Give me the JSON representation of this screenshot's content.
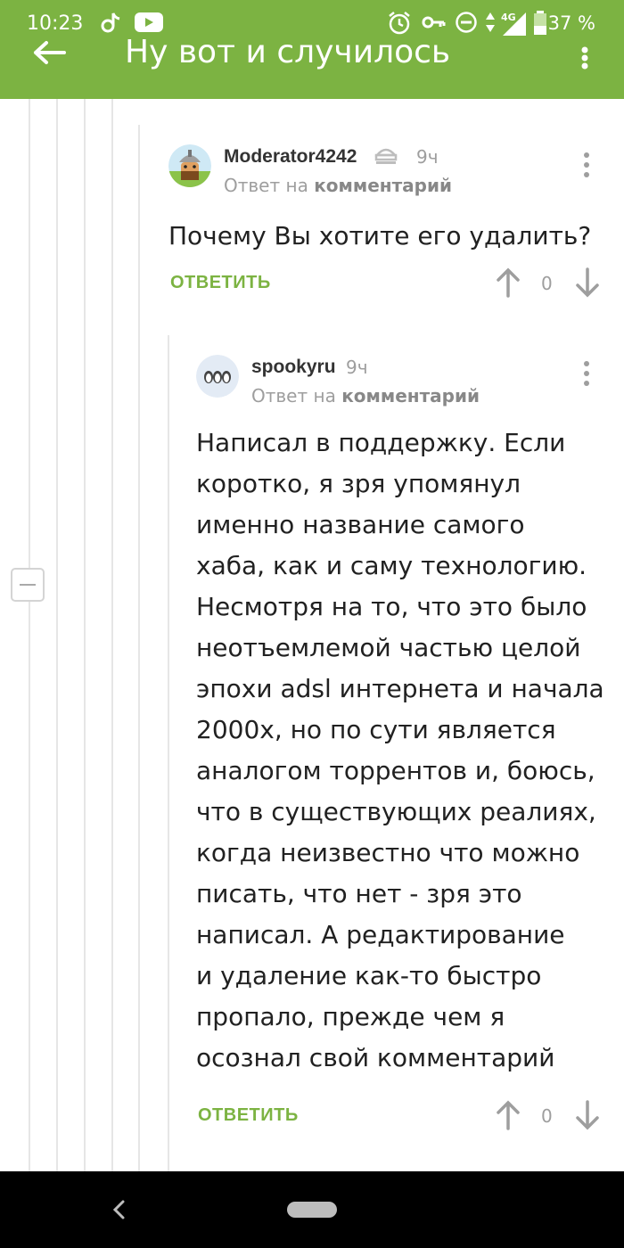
{
  "status_bar": {
    "time": "10:23",
    "network": "4G",
    "battery_percent": "37 %",
    "icons": [
      "tiktok-icon",
      "youtube-icon",
      "alarm-icon",
      "key-icon",
      "do-not-disturb-icon",
      "signal-icon",
      "battery-icon"
    ]
  },
  "toolbar": {
    "title": "Ну вот и случилось"
  },
  "comments": [
    {
      "username": "Moderator4242",
      "time": "9ч",
      "reply_prefix": "Ответ на",
      "reply_target": "комментарий",
      "text": "Почему Вы хотите его удалить?",
      "reply_label": "ОТВЕТИТЬ",
      "votes": "0"
    },
    {
      "username": "spookyru",
      "time": "9ч",
      "reply_prefix": "Ответ на",
      "reply_target": "комментарий",
      "text_lines": [
        "Написал в поддержку. Если",
        "коротко, я зря упомянул",
        "именно название самого",
        "хаба, как и саму технологию.",
        "Несмотря на то, что это было",
        "неотъемлемой частью целой",
        "эпохи adsl интернета и начала",
        "2000х, но по сути является",
        "аналогом торрентов и, боюсь,",
        "что в существующих реалиях,",
        "когда неизвестно что можно",
        "писать, что нет - зря это",
        "написал. А редактирование",
        "и удаление как-то быстро",
        "пропало, прежде чем я",
        "осознал свой комментарий"
      ],
      "reply_label": "ОТВЕТИТЬ",
      "votes": "0"
    }
  ],
  "colors": {
    "accent": "#7cb342",
    "text": "#212121",
    "muted": "#9e9e9e"
  }
}
